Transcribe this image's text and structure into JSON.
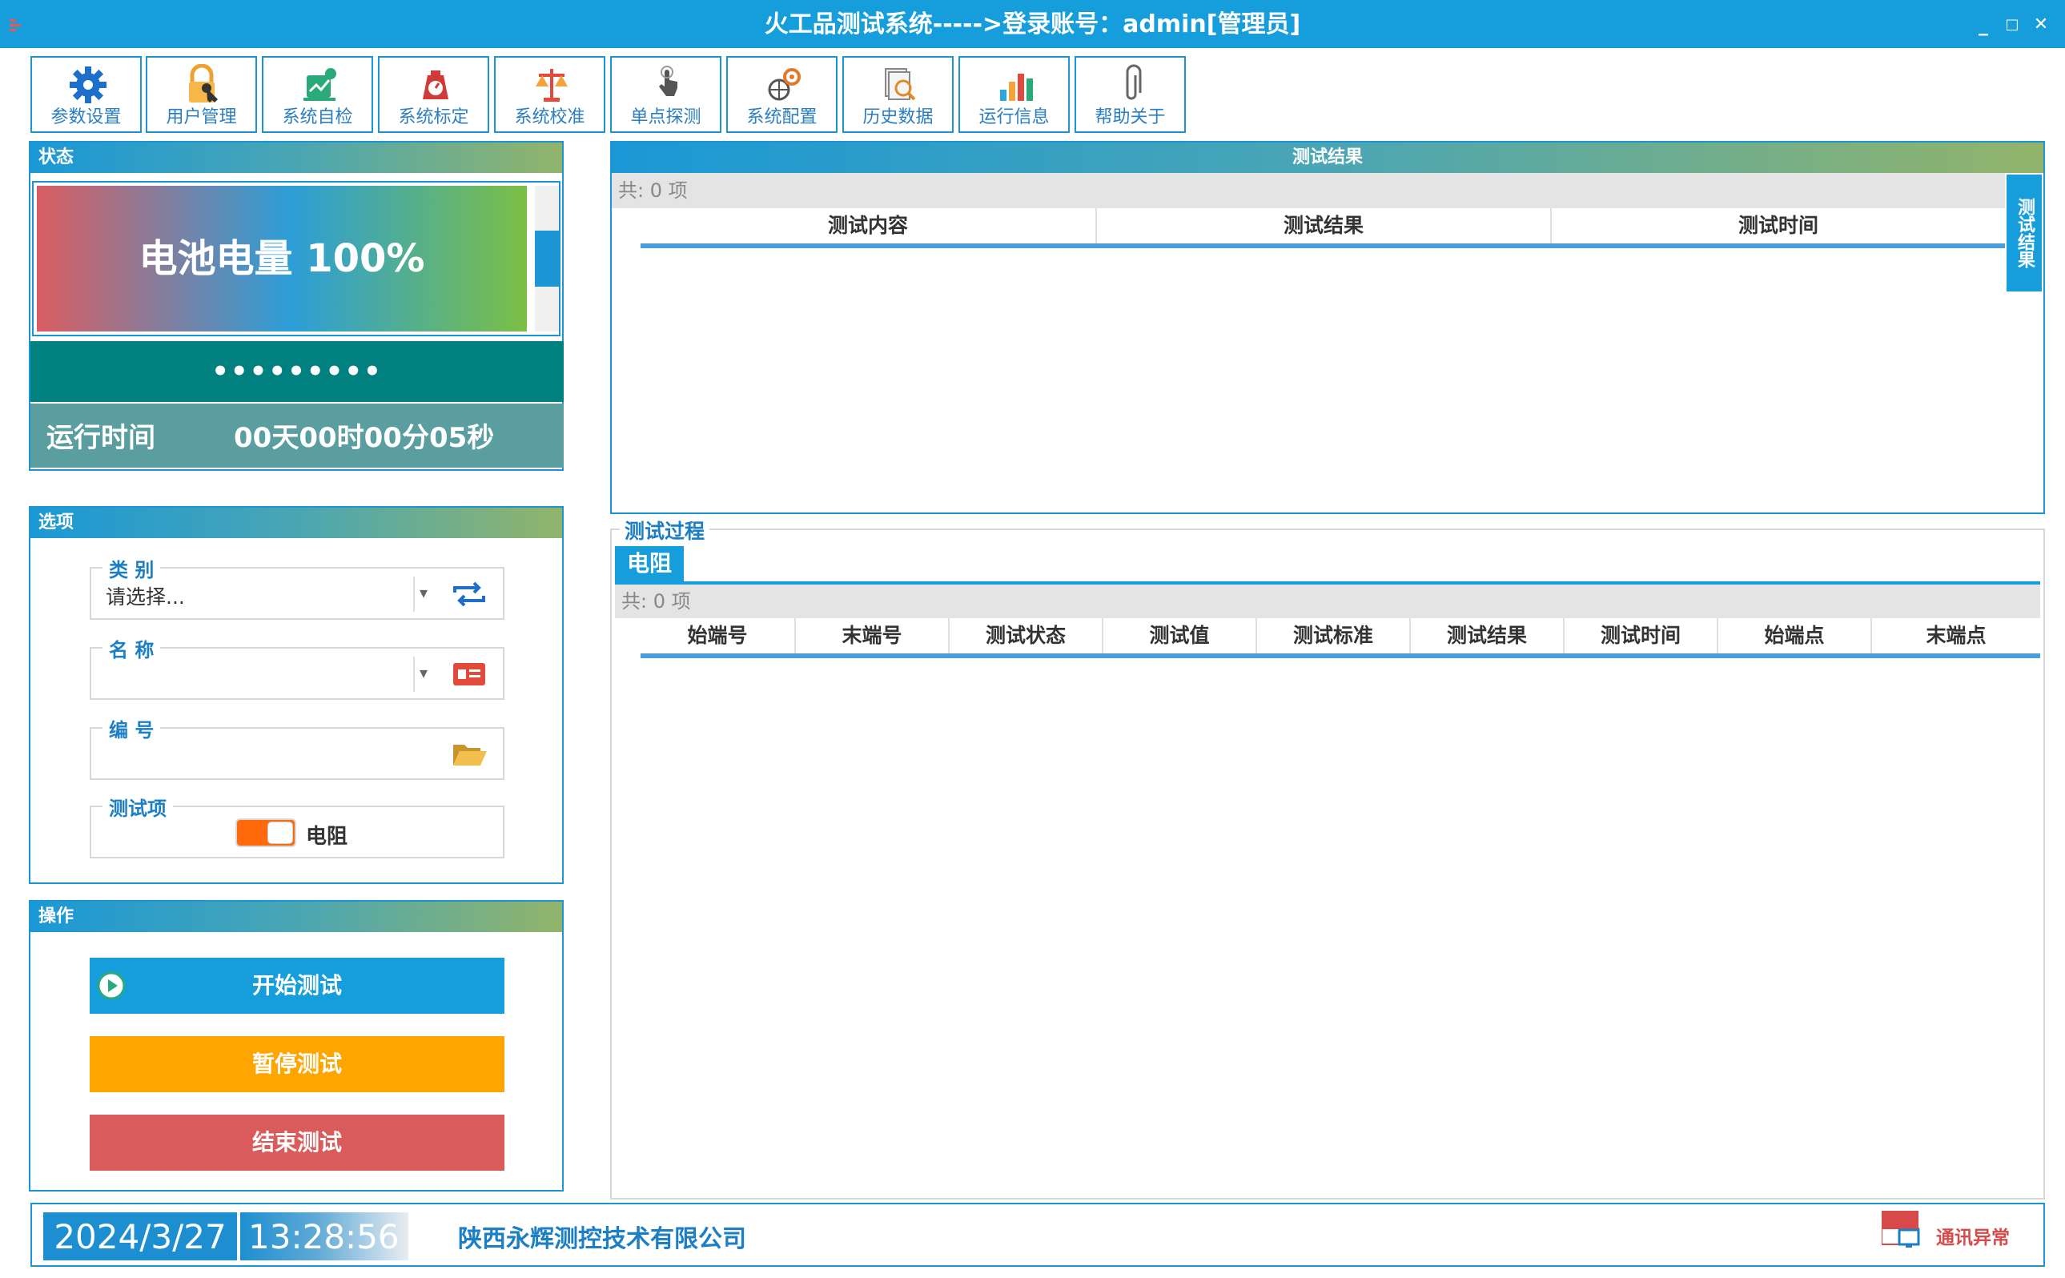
{
  "window": {
    "title": "火工品测试系统----->登录账号：admin[管理员]",
    "minimize": "_",
    "maximize": "□",
    "close": "✕"
  },
  "toolbar": [
    {
      "label": "参数设置",
      "icon": "gear-icon"
    },
    {
      "label": "用户管理",
      "icon": "user-lock-icon"
    },
    {
      "label": "系统自检",
      "icon": "self-check-icon"
    },
    {
      "label": "系统标定",
      "icon": "scale-icon"
    },
    {
      "label": "系统校准",
      "icon": "balance-icon"
    },
    {
      "label": "单点探测",
      "icon": "pointer-icon"
    },
    {
      "label": "系统配置",
      "icon": "config-icon"
    },
    {
      "label": "历史数据",
      "icon": "history-search-icon"
    },
    {
      "label": "运行信息",
      "icon": "bar-chart-icon"
    },
    {
      "label": "帮助关于",
      "icon": "paperclip-icon"
    }
  ],
  "status_panel": {
    "title": "状态",
    "battery_text": "电池电量 100%",
    "battery_level": 1.0,
    "dots": "•••••••••",
    "runtime_label": "运行时间",
    "runtime_value": "00天00时00分05秒"
  },
  "options_panel": {
    "title": "选项",
    "category_label": "类 别",
    "category_value": "请选择...",
    "name_label": "名 称",
    "name_value": "",
    "number_label": "编 号",
    "number_value": "",
    "test_item_label": "测试项",
    "test_item_value": "电阻",
    "test_item_on": true
  },
  "operation_panel": {
    "title": "操作",
    "start": "开始测试",
    "pause": "暂停测试",
    "stop": "结束测试"
  },
  "results_panel": {
    "title": "测试结果",
    "count": "共: 0 项",
    "columns": [
      "测试内容",
      "测试结果",
      "测试时间"
    ],
    "side_tab": "测试结果"
  },
  "process_panel": {
    "title": "测试过程",
    "tab": "电阻",
    "count": "共: 0 项",
    "columns": [
      "始端号",
      "末端号",
      "测试状态",
      "测试值",
      "测试标准",
      "测试结果",
      "测试时间",
      "始端点",
      "末端点"
    ]
  },
  "statusbar": {
    "date": "2024/3/27",
    "time": "13:28:56",
    "company": "陕西永辉测控技术有限公司",
    "comm_status": "通讯异常"
  },
  "colors": {
    "primary": "#169ddc",
    "teal": "#00807f",
    "orange": "#ffa500",
    "red": "#da5b5b"
  }
}
